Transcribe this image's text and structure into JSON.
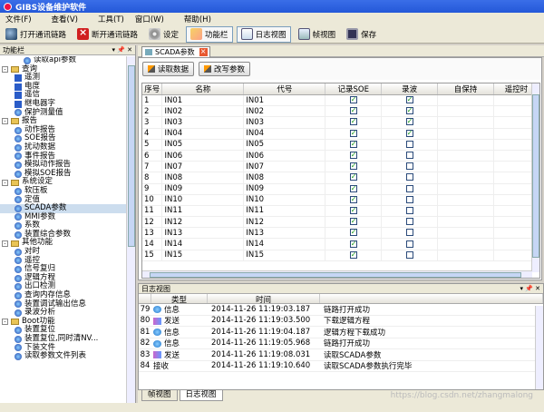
{
  "window": {
    "title": "GIBS设备维护软件"
  },
  "menu": [
    "文件(F)",
    "查看(V)",
    "工具(T)",
    "窗口(W)",
    "帮助(H)"
  ],
  "toolbar": {
    "open": "打开通讯链路",
    "close": "断开通讯链路",
    "settings": "设定",
    "functions": "功能栏",
    "log": "日志视图",
    "frame": "帧视图",
    "save": "保存"
  },
  "sidebar": {
    "title": "功能栏",
    "tree": [
      {
        "level": 2,
        "icon": "globe",
        "label": "读取api参数"
      },
      {
        "level": 0,
        "icon": "folder",
        "expander": "-",
        "label": "查询"
      },
      {
        "level": 1,
        "icon": "blue",
        "label": "遥测"
      },
      {
        "level": 1,
        "icon": "blue",
        "label": "电度"
      },
      {
        "level": 1,
        "icon": "blue",
        "label": "遥信"
      },
      {
        "level": 1,
        "icon": "blue",
        "label": "继电器字"
      },
      {
        "level": 1,
        "icon": "globe",
        "label": "保护测量值"
      },
      {
        "level": 0,
        "icon": "folder",
        "expander": "-",
        "label": "报告"
      },
      {
        "level": 1,
        "icon": "globe",
        "label": "动作报告"
      },
      {
        "level": 1,
        "icon": "globe",
        "label": "SOE报告"
      },
      {
        "level": 1,
        "icon": "globe",
        "label": "扰动数据"
      },
      {
        "level": 1,
        "icon": "globe",
        "label": "事件报告"
      },
      {
        "level": 1,
        "icon": "globe",
        "label": "模拟动作报告"
      },
      {
        "level": 1,
        "icon": "globe",
        "label": "模拟SOE报告"
      },
      {
        "level": 0,
        "icon": "folder",
        "expander": "-",
        "label": "系统设定"
      },
      {
        "level": 1,
        "icon": "globe",
        "label": "软压板"
      },
      {
        "level": 1,
        "icon": "globe",
        "label": "定值"
      },
      {
        "level": 1,
        "icon": "globe",
        "label": "SCADA参数",
        "selected": true
      },
      {
        "level": 1,
        "icon": "globe",
        "label": "MMI参数"
      },
      {
        "level": 1,
        "icon": "globe",
        "label": "系数"
      },
      {
        "level": 1,
        "icon": "globe",
        "label": "装置综合参数"
      },
      {
        "level": 0,
        "icon": "folder",
        "expander": "-",
        "label": "其他功能"
      },
      {
        "level": 1,
        "icon": "globe",
        "label": "对时"
      },
      {
        "level": 1,
        "icon": "globe",
        "label": "遥控"
      },
      {
        "level": 1,
        "icon": "globe",
        "label": "信号复归"
      },
      {
        "level": 1,
        "icon": "globe",
        "label": "逻辑方程"
      },
      {
        "level": 1,
        "icon": "globe",
        "label": "出口检测"
      },
      {
        "level": 1,
        "icon": "globe",
        "label": "查询内存信息"
      },
      {
        "level": 1,
        "icon": "globe",
        "label": "装置调试输出信息"
      },
      {
        "level": 1,
        "icon": "globe",
        "label": "录波分析"
      },
      {
        "level": 0,
        "icon": "folder",
        "expander": "-",
        "label": "Boot功能"
      },
      {
        "level": 1,
        "icon": "globe",
        "label": "装置复位"
      },
      {
        "level": 1,
        "icon": "globe",
        "label": "装置复位,同时清NV..."
      },
      {
        "level": 1,
        "icon": "globe",
        "label": "下装文件"
      },
      {
        "level": 1,
        "icon": "globe",
        "label": "读取参数文件列表"
      }
    ]
  },
  "doc_tab": {
    "label": "SCADA参数"
  },
  "actions": {
    "read": "读取数据",
    "write": "改写参数"
  },
  "grid": {
    "columns": [
      "序号",
      "名称",
      "代号",
      "记录SOE",
      "录波",
      "自保持",
      "遥控时"
    ],
    "rows": [
      {
        "no": "1",
        "name": "IN01",
        "code": "IN01",
        "soe": true,
        "wave": true
      },
      {
        "no": "2",
        "name": "IN02",
        "code": "IN02",
        "soe": true,
        "wave": true
      },
      {
        "no": "3",
        "name": "IN03",
        "code": "IN03",
        "soe": true,
        "wave": true
      },
      {
        "no": "4",
        "name": "IN04",
        "code": "IN04",
        "soe": true,
        "wave": true
      },
      {
        "no": "5",
        "name": "IN05",
        "code": "IN05",
        "soe": true,
        "wave": false
      },
      {
        "no": "6",
        "name": "IN06",
        "code": "IN06",
        "soe": true,
        "wave": false
      },
      {
        "no": "7",
        "name": "IN07",
        "code": "IN07",
        "soe": true,
        "wave": false
      },
      {
        "no": "8",
        "name": "IN08",
        "code": "IN08",
        "soe": true,
        "wave": false
      },
      {
        "no": "9",
        "name": "IN09",
        "code": "IN09",
        "soe": true,
        "wave": false
      },
      {
        "no": "10",
        "name": "IN10",
        "code": "IN10",
        "soe": true,
        "wave": false
      },
      {
        "no": "11",
        "name": "IN11",
        "code": "IN11",
        "soe": true,
        "wave": false
      },
      {
        "no": "12",
        "name": "IN12",
        "code": "IN12",
        "soe": true,
        "wave": false
      },
      {
        "no": "13",
        "name": "IN13",
        "code": "IN13",
        "soe": true,
        "wave": false
      },
      {
        "no": "14",
        "name": "IN14",
        "code": "IN14",
        "soe": true,
        "wave": false
      },
      {
        "no": "15",
        "name": "IN15",
        "code": "IN15",
        "soe": true,
        "wave": false
      }
    ]
  },
  "log": {
    "title": "日志视图",
    "columns": [
      "类型",
      "时间"
    ],
    "rows": [
      {
        "id": "79",
        "icon": "info",
        "type": "信息",
        "time": "2014-11-26 11:19:03.187",
        "msg": "链路打开成功"
      },
      {
        "id": "80",
        "icon": "send",
        "type": "发送",
        "time": "2014-11-26 11:19:03.500",
        "msg": "下载逻辑方程"
      },
      {
        "id": "81",
        "icon": "info",
        "type": "信息",
        "time": "2014-11-26 11:19:04.187",
        "msg": "逻辑方程下载成功"
      },
      {
        "id": "82",
        "icon": "info",
        "type": "信息",
        "time": "2014-11-26 11:19:05.968",
        "msg": "链路打开成功"
      },
      {
        "id": "83",
        "icon": "send",
        "type": "发送",
        "time": "2014-11-26 11:19:08.031",
        "msg": "读取SCADA参数"
      },
      {
        "id": "84",
        "icon": "none",
        "type": "接收",
        "time": "2014-11-26 11:19:10.640",
        "msg": "读取SCADA参数执行完毕"
      }
    ]
  },
  "bottom_tabs": [
    "帧视图",
    "日志视图"
  ],
  "watermark": "https://blog.csdn.net/zhangmalong"
}
